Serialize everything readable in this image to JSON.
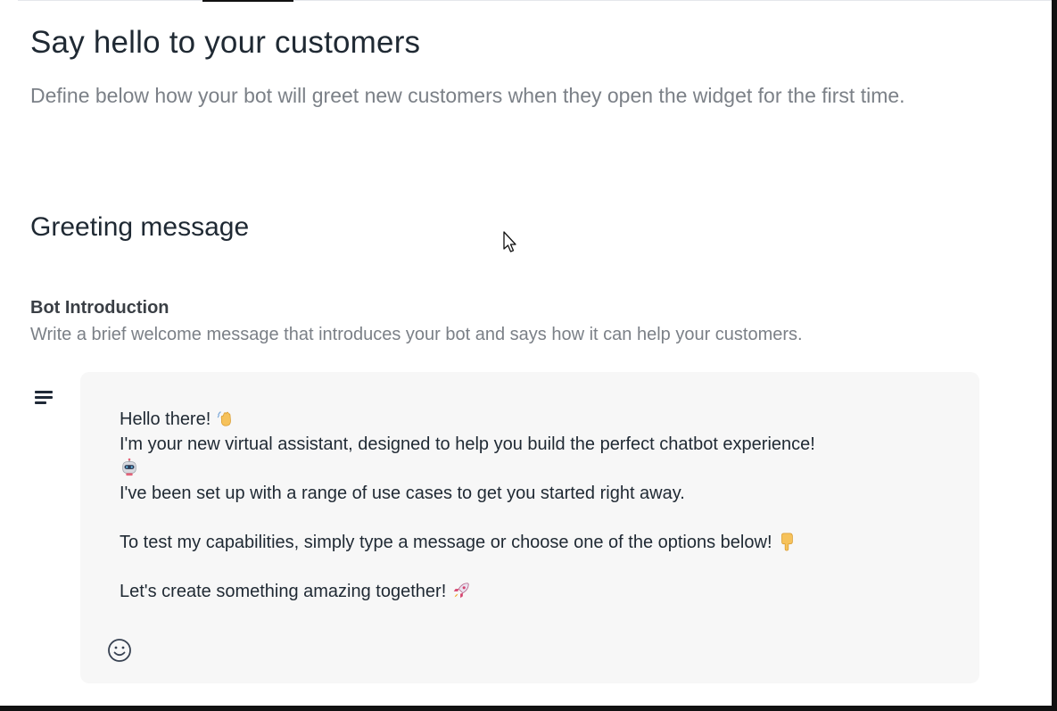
{
  "header": {
    "title": "Say hello to your customers",
    "subtitle": "Define below how your bot will greet new customers when they open the widget for the first time."
  },
  "section": {
    "title": "Greeting message"
  },
  "field": {
    "label": "Bot Introduction",
    "help": "Write a brief welcome message that introduces your bot and says how it can help your customers."
  },
  "message": {
    "line1": "Hello there! ",
    "line2": "I'm your new virtual assistant, designed to help you build the perfect chatbot experience!",
    "line3": "I've been set up with a range of use cases to get you started right away.",
    "line4": "To test my capabilities, simply type a message or choose one of the options below! ",
    "line5": "Let's create something amazing together! ",
    "emojis": [
      "waving-hand",
      "robot",
      "pointing-down",
      "rocket"
    ]
  },
  "icons": {
    "format": "text-format-icon",
    "emoji_picker": "smiley-icon",
    "pointer": "mouse-cursor"
  }
}
